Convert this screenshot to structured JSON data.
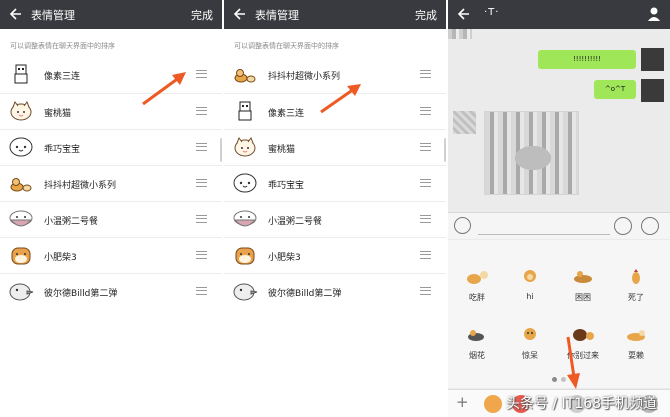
{
  "panel_left": {
    "title": "表情管理",
    "done": "完成",
    "hint": "可以调整表情在聊天界面中的排序",
    "items": [
      {
        "name": "像素三连"
      },
      {
        "name": "蜜桃猫"
      },
      {
        "name": "乖巧宝宝"
      },
      {
        "name": "抖抖村超微小系列"
      },
      {
        "name": "小温粥二号餐"
      },
      {
        "name": "小肥柴3"
      },
      {
        "name": "彼尔德Billd第二弹"
      }
    ]
  },
  "panel_middle": {
    "title": "表情管理",
    "done": "完成",
    "hint": "可以调整表情在聊天界面中的排序",
    "items": [
      {
        "name": "抖抖村超微小系列"
      },
      {
        "name": "像素三连"
      },
      {
        "name": "蜜桃猫"
      },
      {
        "name": "乖巧宝宝"
      },
      {
        "name": "小温粥二号餐"
      },
      {
        "name": "小肥柴3"
      },
      {
        "name": "彼尔德Billd第二弹"
      }
    ]
  },
  "chat": {
    "contact_name": "·T·",
    "bubble1": "!!!!!!!!!!",
    "bubble2": "^o^T",
    "stickers": [
      {
        "label": "吃胖"
      },
      {
        "label": "hi"
      },
      {
        "label": "困困"
      },
      {
        "label": "死了"
      },
      {
        "label": "烟花"
      },
      {
        "label": "惊呆"
      },
      {
        "label": "你别过来"
      },
      {
        "label": "耍赖"
      }
    ]
  },
  "watermark": "头条号 / IT168手机频道",
  "colors": {
    "titlebar": "#393a3f",
    "bubble": "#9fe658",
    "arrow": "#ee5a24"
  }
}
